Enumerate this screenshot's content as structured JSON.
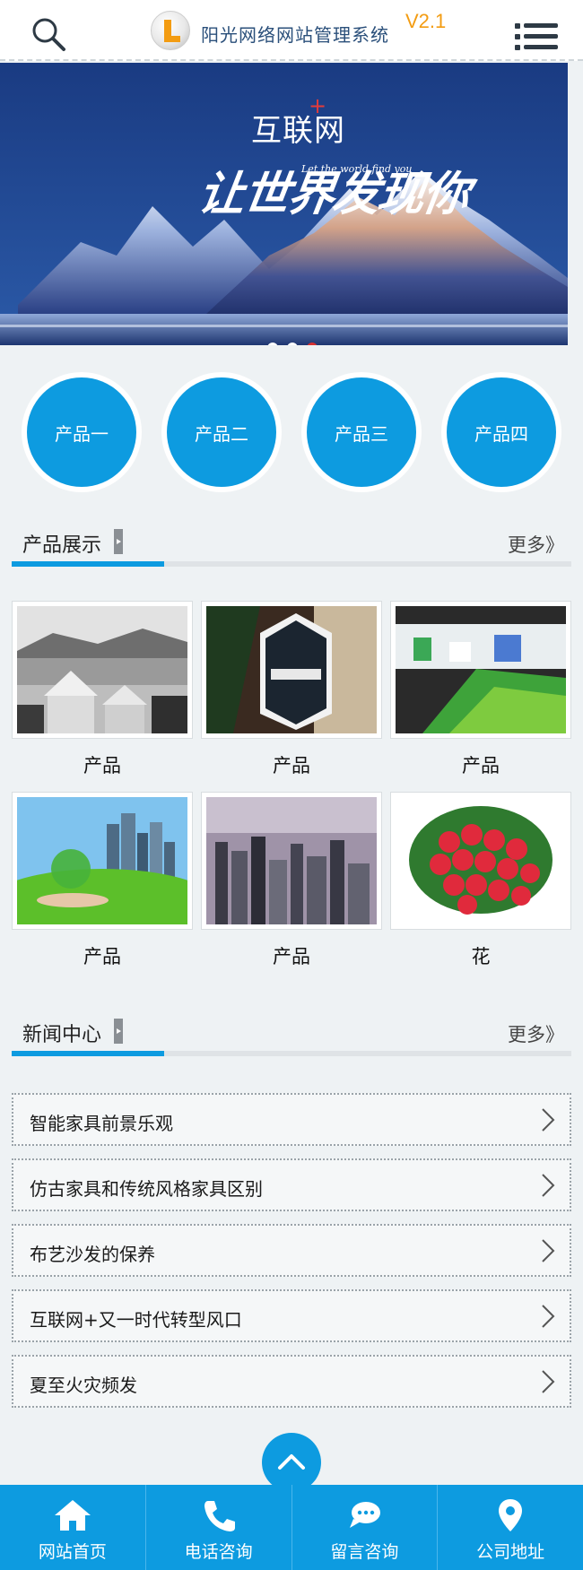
{
  "header": {
    "title": "阳光网络网站管理系统",
    "version": "V2.1",
    "search_icon": "search-icon",
    "menu_icon": "menu-icon"
  },
  "banner": {
    "heading": "互联网",
    "heading_mark": "+",
    "slogan": "让世界发现你",
    "tagline": "Let the world find you",
    "slides": 3,
    "active_slide": 3,
    "colors": {
      "sky": "#1b3f86",
      "active_dot": "#d63030"
    }
  },
  "categories": [
    {
      "label": "产品一"
    },
    {
      "label": "产品二"
    },
    {
      "label": "产品三"
    },
    {
      "label": "产品四"
    }
  ],
  "products_section": {
    "title": "产品展示",
    "more": "更多》",
    "items": [
      {
        "name": "产品",
        "image": "coastal-town-bw"
      },
      {
        "name": "产品",
        "image": "republica-tag"
      },
      {
        "name": "产品",
        "image": "exhibition-booth"
      },
      {
        "name": "产品",
        "image": "green-globe-city"
      },
      {
        "name": "产品",
        "image": "city-skyline"
      },
      {
        "name": "花",
        "image": "red-roses-bouquet"
      }
    ]
  },
  "news_section": {
    "title": "新闻中心",
    "more": "更多》",
    "items": [
      {
        "title": "智能家具前景乐观"
      },
      {
        "title": "仿古家具和传统风格家具区别"
      },
      {
        "title": "布艺沙发的保养"
      },
      {
        "title": "互联网+又一时代转型风口"
      },
      {
        "title": "夏至火灾频发"
      }
    ]
  },
  "back_to_top_icon": "chevron-up-icon",
  "bottom_nav": [
    {
      "label": "网站首页",
      "icon": "home-icon"
    },
    {
      "label": "电话咨询",
      "icon": "phone-icon"
    },
    {
      "label": "留言咨询",
      "icon": "chat-icon"
    },
    {
      "label": "公司地址",
      "icon": "location-icon"
    }
  ],
  "colors": {
    "accent": "#0d9be0",
    "background": "#eef2f4",
    "version": "#f39c12"
  }
}
